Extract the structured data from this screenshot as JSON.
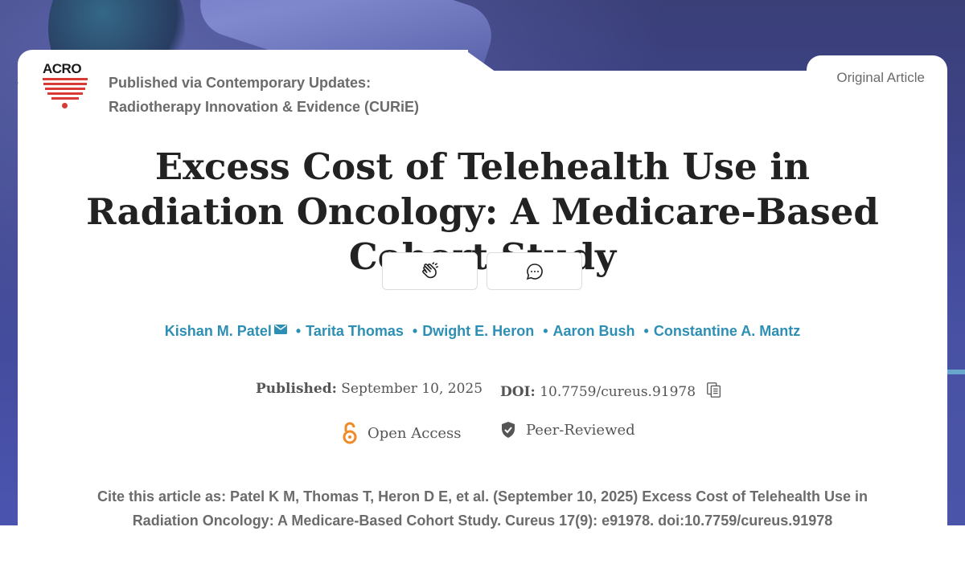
{
  "publisher": {
    "logo_text": "ACRO",
    "line1": "Published via Contemporary Updates:",
    "line2": "Radiotherapy Innovation & Evidence (CURiE)"
  },
  "article_type": "Original Article",
  "title": "Excess Cost of Telehealth Use in Radiation Oncology: A Medicare-Based Cohort Study",
  "actions": {
    "clap_icon": "clap-icon",
    "comment_icon": "comment-icon"
  },
  "authors": [
    "Kishan M. Patel",
    "Tarita Thomas",
    "Dwight E. Heron",
    "Aaron Bush",
    "Constantine A. Mantz"
  ],
  "author_separator": "•",
  "meta": {
    "published_label": "Published:",
    "published_date": "September 10, 2025",
    "doi_label": "DOI:",
    "doi_value": "10.7759/cureus.91978"
  },
  "badges": {
    "open_access": "Open Access",
    "peer_reviewed": "Peer-Reviewed"
  },
  "citation": "Cite this article as: Patel K M, Thomas T, Heron D E, et al. (September 10, 2025) Excess Cost of Telehealth Use in Radiation Oncology: A Medicare-Based Cohort Study. Cureus 17(9): e91978. doi:10.7759/cureus.91978",
  "colors": {
    "link": "#2e8fb5",
    "open_access": "#f08a24",
    "brand_red": "#d83a35"
  }
}
